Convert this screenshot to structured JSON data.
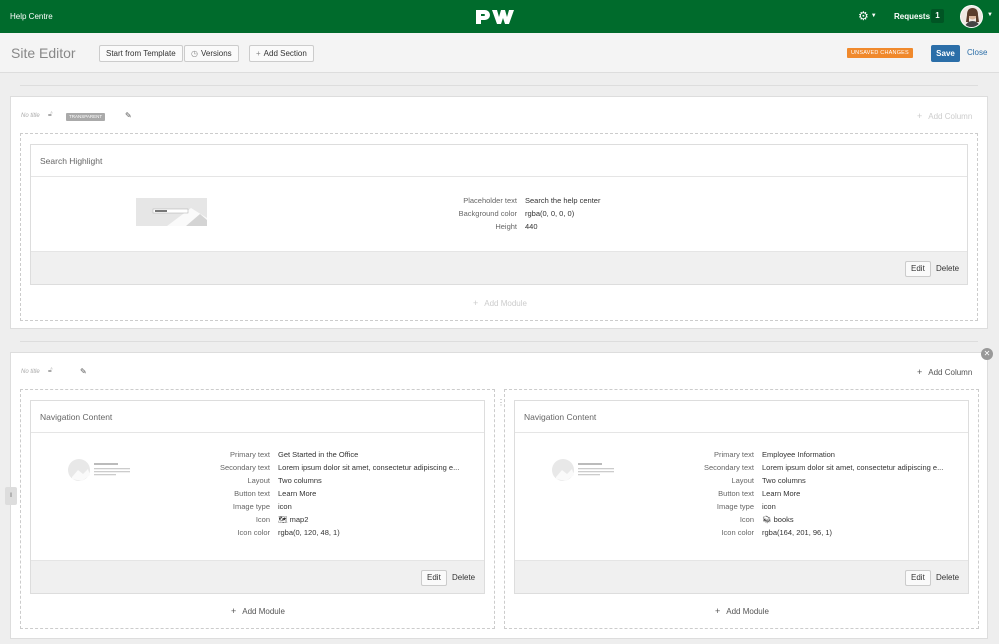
{
  "topbar": {
    "brand": "Help Centre",
    "logo_text": "PW",
    "requests_label": "Requests",
    "requests_count": "1",
    "colors": {
      "bar": "#006b2c"
    }
  },
  "editor": {
    "title": "Site Editor",
    "start_template": "Start from Template",
    "versions": "Versions",
    "add_section": "Add Section",
    "unsaved": "UNSAVED CHANGES",
    "save": "Save",
    "close": "Close"
  },
  "section1": {
    "no_title": "No title",
    "tag": "TRANSPARENT",
    "add_column": "Add Column",
    "module": {
      "title": "Search Highlight",
      "fields": [
        {
          "k": "Placeholder text",
          "v": "Search the help center"
        },
        {
          "k": "Background color",
          "v": "rgba(0, 0, 0, 0)"
        },
        {
          "k": "Height",
          "v": "440"
        }
      ],
      "edit": "Edit",
      "delete": "Delete"
    },
    "add_module": "Add Module"
  },
  "section2": {
    "no_title": "No title",
    "add_column": "Add Column",
    "columns": [
      {
        "module": {
          "title": "Navigation Content",
          "fields": [
            {
              "k": "Primary text",
              "v": "Get Started in the Office"
            },
            {
              "k": "Secondary text",
              "v": "Lorem ipsum dolor sit amet, consectetur adipiscing e..."
            },
            {
              "k": "Layout",
              "v": "Two columns"
            },
            {
              "k": "Button text",
              "v": "Learn More"
            },
            {
              "k": "Image type",
              "v": "icon"
            },
            {
              "k": "Icon",
              "v": "map2"
            },
            {
              "k": "Icon color",
              "v": "rgba(0, 120, 48, 1)"
            }
          ],
          "edit": "Edit",
          "delete": "Delete"
        },
        "add_module": "Add Module"
      },
      {
        "module": {
          "title": "Navigation Content",
          "fields": [
            {
              "k": "Primary text",
              "v": "Employee Information"
            },
            {
              "k": "Secondary text",
              "v": "Lorem ipsum dolor sit amet, consectetur adipiscing e..."
            },
            {
              "k": "Layout",
              "v": "Two columns"
            },
            {
              "k": "Button text",
              "v": "Learn More"
            },
            {
              "k": "Image type",
              "v": "icon"
            },
            {
              "k": "Icon",
              "v": "books"
            },
            {
              "k": "Icon color",
              "v": "rgba(164, 201, 96, 1)"
            }
          ],
          "edit": "Edit",
          "delete": "Delete"
        },
        "add_module": "Add Module"
      }
    ]
  }
}
